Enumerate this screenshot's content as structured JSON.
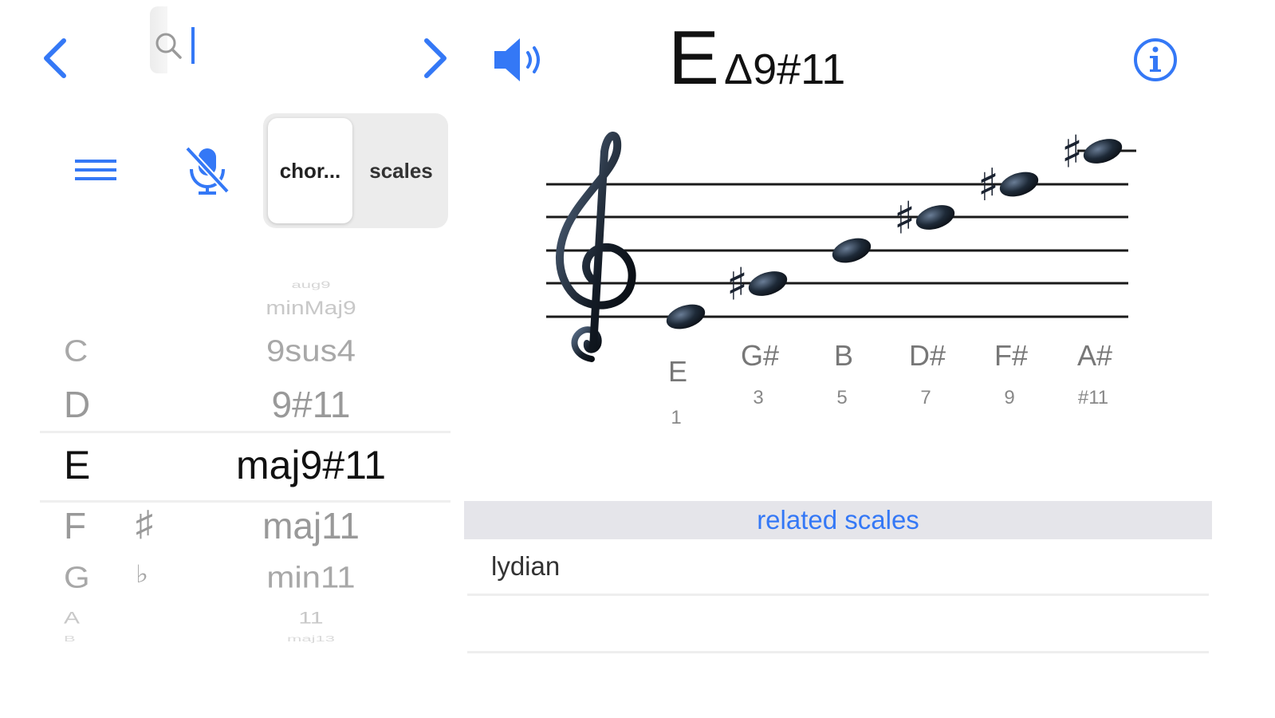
{
  "nav": {
    "back": "back",
    "forward": "forward"
  },
  "search": {
    "value": "",
    "placeholder": ""
  },
  "mode": {
    "options": [
      "chor...",
      "scales"
    ],
    "selected": "chor..."
  },
  "picker": {
    "roots": [
      {
        "label": "C",
        "accidental": "",
        "quality": "9sus4",
        "state": "near"
      },
      {
        "label": "D",
        "accidental": "",
        "quality": "9#11",
        "state": "near"
      },
      {
        "label": "E",
        "accidental": "",
        "quality": "maj9#11",
        "state": "selected"
      },
      {
        "label": "F",
        "accidental": "♯",
        "quality": "maj11",
        "state": "near"
      },
      {
        "label": "G",
        "accidental": "♭",
        "quality": "min11",
        "state": "near"
      }
    ],
    "faded_above": [
      "aug9",
      "minMaj9"
    ],
    "faded_below": [
      "A",
      "11",
      "B",
      "maj13"
    ]
  },
  "chord": {
    "root": "E",
    "quality": "Δ9#11"
  },
  "notes": [
    {
      "name": "E",
      "degree": "1"
    },
    {
      "name": "G#",
      "degree": "3"
    },
    {
      "name": "B",
      "degree": "5"
    },
    {
      "name": "D#",
      "degree": "7"
    },
    {
      "name": "F#",
      "degree": "9"
    },
    {
      "name": "A#",
      "degree": "#11"
    }
  ],
  "related": {
    "title": "related scales",
    "scales": [
      "lydian",
      ""
    ]
  },
  "colors": {
    "accent": "#3478f6",
    "selected_text": "#111111",
    "dim_text": "#9a9a9a",
    "section_header": "#e5e5ea"
  },
  "icons": {
    "back": "chevron-left-icon",
    "forward": "chevron-right-icon",
    "search": "search-icon",
    "menu": "menu-icon",
    "mic": "mic-off-icon",
    "speaker": "speaker-icon",
    "info": "info-icon"
  }
}
